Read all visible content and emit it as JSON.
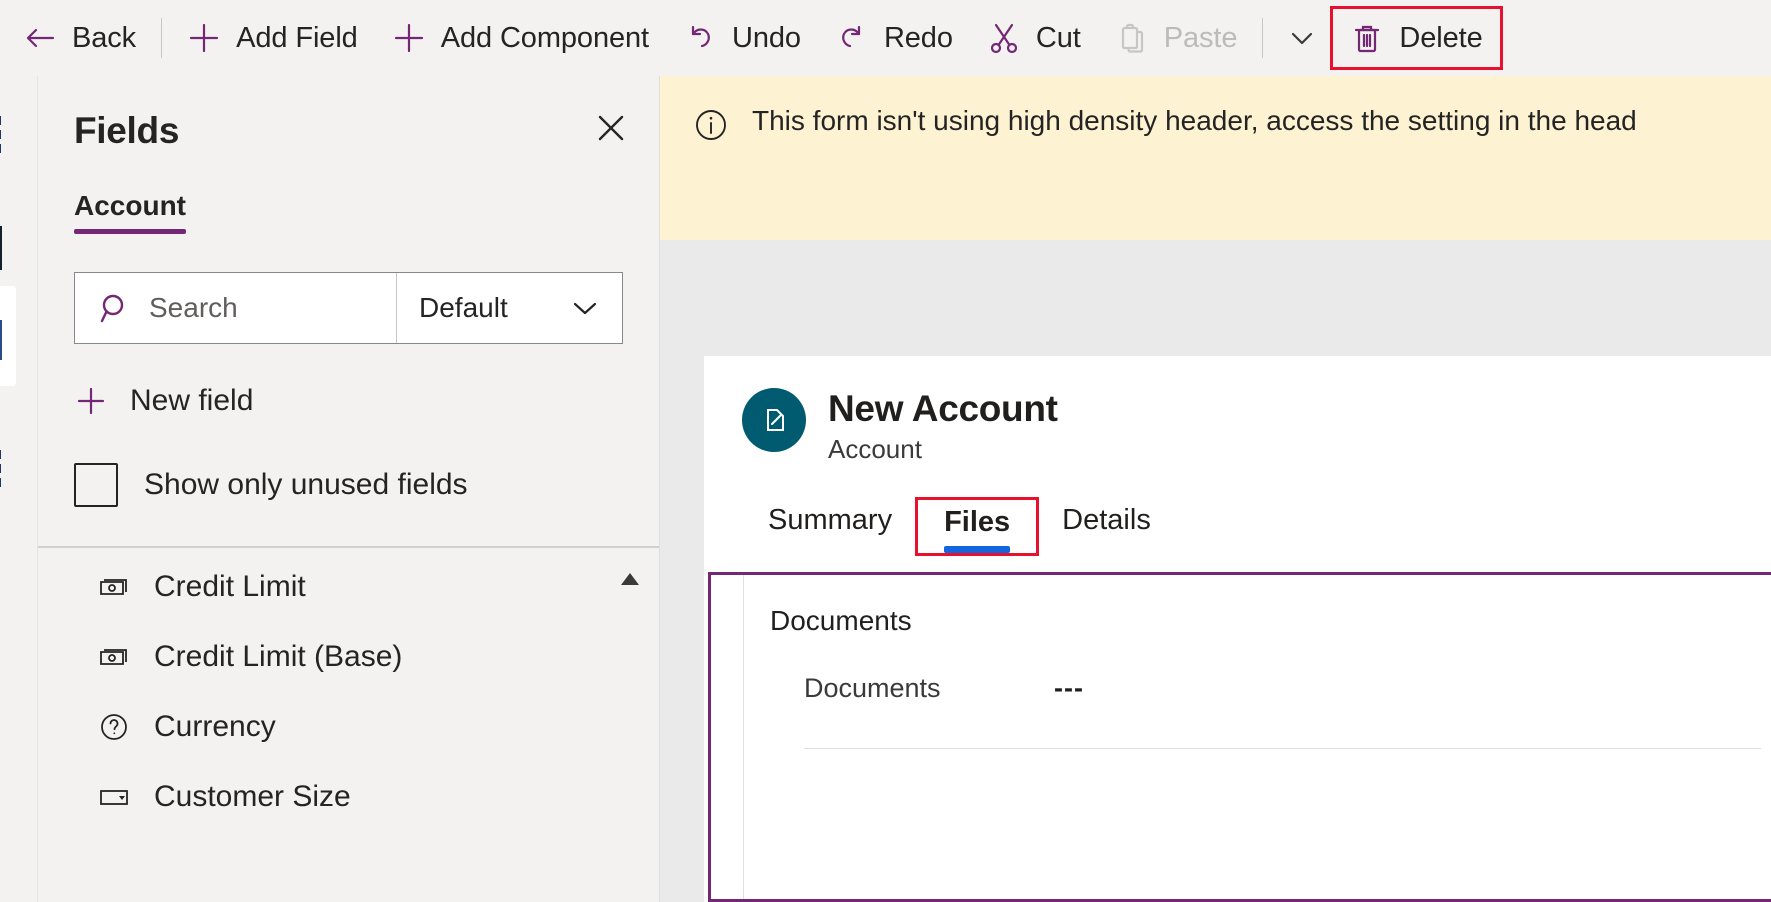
{
  "commandbar": {
    "items": [
      {
        "label": "Back",
        "icon": "arrow-left-icon",
        "name": "back-button",
        "disabled": false,
        "highlight": false
      },
      {
        "label": "Add Field",
        "icon": "plus-icon",
        "name": "add-field-button",
        "disabled": false,
        "highlight": false
      },
      {
        "label": "Add Component",
        "icon": "plus-icon",
        "name": "add-component-button",
        "disabled": false,
        "highlight": false
      },
      {
        "label": "Undo",
        "icon": "undo-icon",
        "name": "undo-button",
        "disabled": false,
        "highlight": false
      },
      {
        "label": "Redo",
        "icon": "redo-icon",
        "name": "redo-button",
        "disabled": false,
        "highlight": false
      },
      {
        "label": "Cut",
        "icon": "scissors-icon",
        "name": "cut-button",
        "disabled": false,
        "highlight": false
      },
      {
        "label": "Paste",
        "icon": "clipboard-icon",
        "name": "paste-button",
        "disabled": true,
        "highlight": false
      },
      {
        "label": "Delete",
        "icon": "trash-icon",
        "name": "delete-button",
        "disabled": false,
        "highlight": true
      }
    ],
    "overflow_label": "More commands"
  },
  "fields_panel": {
    "title": "Fields",
    "close_label": "Close",
    "tabs": [
      {
        "label": "Account",
        "active": true
      }
    ],
    "search": {
      "placeholder": "Search",
      "value": "",
      "scope_value": "Default",
      "scope_options": [
        "Default"
      ]
    },
    "new_field_label": "New field",
    "show_unused": {
      "label": "Show only unused fields",
      "checked": false
    },
    "field_list": [
      {
        "label": "Credit Limit",
        "icon": "currency-icon"
      },
      {
        "label": "Credit Limit (Base)",
        "icon": "currency-icon"
      },
      {
        "label": "Currency",
        "icon": "lookup-icon"
      },
      {
        "label": "Customer Size",
        "icon": "choice-icon"
      }
    ]
  },
  "notification": {
    "icon": "info-icon",
    "text": "This form isn't using high density header, access the setting in the head"
  },
  "form": {
    "entity_icon": "account-entity-icon",
    "record_title": "New Account",
    "entity_name": "Account",
    "tabs": [
      {
        "label": "Summary",
        "active": false,
        "selected": false
      },
      {
        "label": "Files",
        "active": true,
        "selected": true
      },
      {
        "label": "Details",
        "active": false,
        "selected": false
      }
    ],
    "section": {
      "title": "Documents",
      "selected": true,
      "rows": [
        {
          "name": "Documents",
          "value": "---"
        }
      ]
    }
  },
  "colors": {
    "brand_purple": "#742774",
    "selection_red": "#e8112d",
    "tab_blue": "#1267de",
    "entity_teal": "#005b70",
    "notif_yellow": "#fdf3d2",
    "app_gray": "#f3f2f1"
  }
}
